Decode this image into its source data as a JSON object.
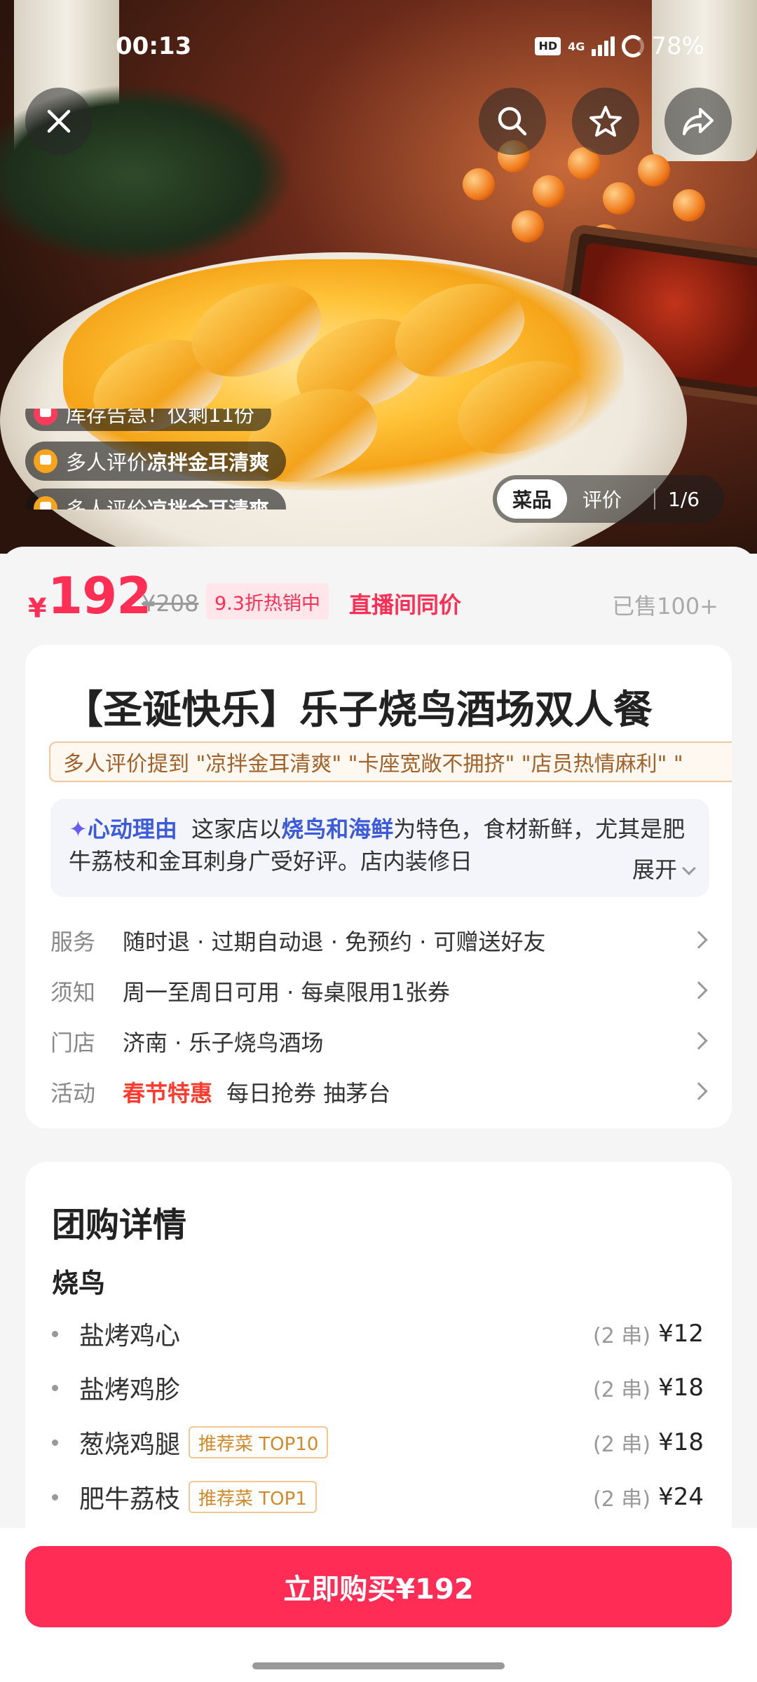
{
  "status_bar": {
    "time": "00:13",
    "network": "4G",
    "battery": "78%"
  },
  "hero": {
    "pill_stock": "库存告急！仅剩11份",
    "pill_review_prefix": "多人评价",
    "pill_review_dish": "凉拌金耳清爽",
    "tabs": [
      "菜品",
      "评价"
    ],
    "active_tab": "菜品",
    "counter": "1/6"
  },
  "price": {
    "currency": "¥",
    "current": "192",
    "original": "¥208",
    "discount": "9.3折热销中",
    "live_tag": "直播间同价",
    "sold": "已售100+"
  },
  "product": {
    "title": "【圣诞快乐】乐子烧鸟酒场双人餐",
    "tags": "多人评价提到 \"凉拌金耳清爽\" \"卡座宽敞不拥挤\" \"店员热情麻利\" \"",
    "reason_label": "心动理由",
    "reason_text_1": "这家店以",
    "reason_highlight": "烧鸟和海鲜",
    "reason_text_2": "为特色，食材新鲜，尤其是肥牛荔枝和金耳刺身广受好评。店内装修日",
    "expand": "展开"
  },
  "info": [
    {
      "key": "服务",
      "value": "随时退 · 过期自动退 · 免预约 · 可赠送好友"
    },
    {
      "key": "须知",
      "value": "周一至周日可用 · 每桌限用1张券"
    },
    {
      "key": "门店",
      "value": "济南 · 乐子烧鸟酒场"
    },
    {
      "key": "活动",
      "promo": "春节特惠",
      "value": "每日抢券 抽茅台"
    }
  ],
  "details": {
    "title": "团购详情",
    "category": "烧鸟",
    "dishes": [
      {
        "name": "盐烤鸡心",
        "badge": "",
        "qty": "(2 串)",
        "price": "¥12"
      },
      {
        "name": "盐烤鸡胗",
        "badge": "",
        "qty": "(2 串)",
        "price": "¥18"
      },
      {
        "name": "葱烧鸡腿",
        "badge": "推荐菜 TOP10",
        "qty": "(2 串)",
        "price": "¥18"
      },
      {
        "name": "肥牛荔枝",
        "badge": "推荐菜 TOP1",
        "qty": "(2 串)",
        "price": "¥24"
      }
    ]
  },
  "buy_button": "立即购买¥192",
  "colors": {
    "accent": "#ff2d55",
    "link_blue": "#3b5bdb",
    "promo_red": "#ff3b2f"
  }
}
